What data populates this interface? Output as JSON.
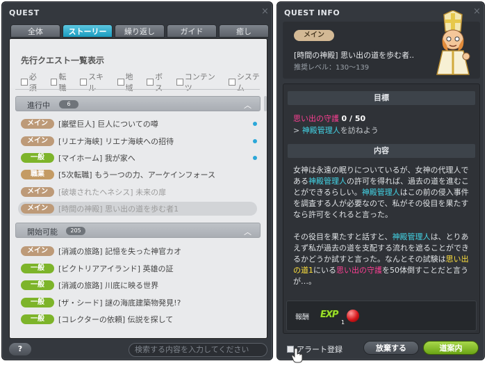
{
  "left_panel": {
    "title": "QUEST",
    "close": "×",
    "tabs": [
      "全体",
      "ストーリー",
      "繰り返し",
      "ガイド",
      "癒し"
    ],
    "active_tab": 1,
    "filter_title": "先行クエスト一覧表示",
    "filters": [
      "必須",
      "転職",
      "スキル",
      "地域",
      "ボス",
      "コンテンツ",
      "システム"
    ],
    "in_progress": {
      "label": "進行中",
      "count": "6",
      "items": [
        {
          "tag": "メイン",
          "tag_type": "main",
          "text": "[巌壁巨人] 巨人についての噂",
          "dot": true,
          "dim": false
        },
        {
          "tag": "メイン",
          "tag_type": "main",
          "text": "[リエナ海峡] リエナ海峡への招待",
          "dot": true,
          "dim": false
        },
        {
          "tag": "一般",
          "tag_type": "general",
          "text": "[マイホーム] 我が家へ",
          "dot": true,
          "dim": false
        },
        {
          "tag": "職業",
          "tag_type": "job",
          "text": "[5次転職] もう一つの力、アーケインフォース",
          "dot": false,
          "dim": false
        },
        {
          "tag": "メイン",
          "tag_type": "main",
          "text": "[破壊されたヘネシス] 未来の扉",
          "dot": false,
          "dim": true
        },
        {
          "tag": "メイン",
          "tag_type": "main",
          "text": "[時間の神殿] 思い出の道を歩む者1",
          "dot": false,
          "dim": true
        }
      ]
    },
    "available": {
      "label": "開始可能",
      "count": "205",
      "items": [
        {
          "tag": "メイン",
          "tag_type": "main",
          "text": "[消滅の旅路] 記憶を失った神官カオ"
        },
        {
          "tag": "一般",
          "tag_type": "general",
          "text": "[ビクトリアアイランド] 英雄の証"
        },
        {
          "tag": "一般",
          "tag_type": "general",
          "text": "[消滅の旅路] 川底に映る世界"
        },
        {
          "tag": "一般",
          "tag_type": "general",
          "text": "[ザ・シード] 謎の海底建築物発見!?"
        },
        {
          "tag": "一般",
          "tag_type": "general",
          "text": "[コレクターの依頼] 伝説を探して"
        }
      ]
    },
    "help_label": "?",
    "search_placeholder": "検索する内容を入力してください"
  },
  "right_panel": {
    "title": "QUEST INFO",
    "close": "×",
    "tag": "メイン",
    "quest_name": "[時間の神殿] 思い出の道を歩む者..",
    "recommended_level": "推奨レベル：130～139",
    "objective_header": "目標",
    "objective_target": "思い出の守護",
    "objective_progress": "0 / 50",
    "objective_sub_prefix": "> ",
    "objective_sub_npc": "神殿管理人",
    "objective_sub_suffix": "を訪ねよう",
    "content_header": "内容",
    "para1": {
      "a": "女神は永遠の眠りについているが、女神の代理人である",
      "npc1": "神殿管理人",
      "b": "の許可を得れば、過去の道を進むことができるらしい。",
      "npc2": "神殿管理人",
      "c": "はこの前の侵入事件を調査する人が必要なので、私がその役目を果たすなら許可をくれると言った。"
    },
    "para2": {
      "a": "その役目を果たすと話すと、",
      "npc": "神殿管理人",
      "b": "は、とりあえず私が過去の道を支配する流れを遮ることができるかどうか試すと言った。なんとその試験は",
      "place": "思い出の道1",
      "c": "にいる",
      "monster": "思い出の守護",
      "d": "を50体倒すことだと言うが…。"
    },
    "reward_label": "報酬",
    "reward_exp": "EXP",
    "reward_count": "1",
    "alert_label": "アラート登録",
    "abandon_label": "放棄する",
    "guide_label": "道案内"
  }
}
